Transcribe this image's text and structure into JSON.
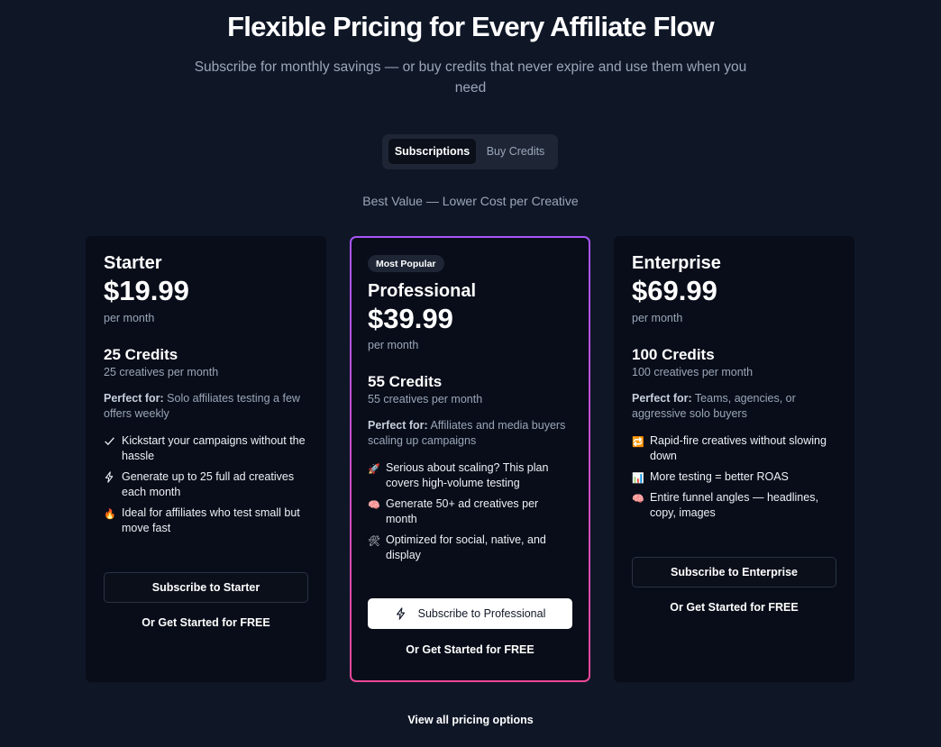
{
  "hero": {
    "title": "Flexible Pricing for Every Affiliate Flow",
    "subtitle": "Subscribe for monthly savings — or buy credits that never expire and use them when you need"
  },
  "toggle": {
    "active": "Subscriptions",
    "inactive": "Buy Credits"
  },
  "best_value": "Best Value — Lower Cost per Creative",
  "plans": [
    {
      "name": "Starter",
      "price": "$19.99",
      "period": "per month",
      "credits": "25 Credits",
      "credits_sub": "25 creatives per month",
      "perfect_label": "Perfect for:",
      "perfect_text": " Solo affiliates testing a few offers weekly",
      "features": [
        {
          "icon": "check-icon",
          "glyph": "✓",
          "text": "Kickstart your campaigns without the hassle"
        },
        {
          "icon": "lightning-icon",
          "glyph": "⚡",
          "text": "Generate up to 25 full ad creatives each month"
        },
        {
          "icon": "fire-icon",
          "glyph": "🔥",
          "text": "Ideal for affiliates who test small but move fast"
        }
      ],
      "button": "Subscribe to Starter",
      "free": "Or Get Started for FREE"
    },
    {
      "badge": "Most Popular",
      "name": "Professional",
      "price": "$39.99",
      "period": "per month",
      "credits": "55 Credits",
      "credits_sub": "55 creatives per month",
      "perfect_label": "Perfect for:",
      "perfect_text": " Affiliates and media buyers scaling up campaigns",
      "features": [
        {
          "icon": "rocket-icon",
          "glyph": "🚀",
          "text": "Serious about scaling? This plan covers high-volume testing"
        },
        {
          "icon": "brain-icon",
          "glyph": "🧠",
          "text": "Generate 50+ ad creatives per month"
        },
        {
          "icon": "tools-icon",
          "glyph": "🛠",
          "text": "Optimized for social, native, and display"
        }
      ],
      "button": "Subscribe to Professional",
      "free": "Or Get Started for FREE"
    },
    {
      "name": "Enterprise",
      "price": "$69.99",
      "period": "per month",
      "credits": "100 Credits",
      "credits_sub": "100 creatives per month",
      "perfect_label": "Perfect for:",
      "perfect_text": " Teams, agencies, or aggressive solo buyers",
      "features": [
        {
          "icon": "repeat-icon",
          "glyph": "🔁",
          "text": "Rapid-fire creatives without slowing down"
        },
        {
          "icon": "chart-icon",
          "glyph": "📊",
          "text": "More testing = better ROAS"
        },
        {
          "icon": "brain-icon",
          "glyph": "🧠",
          "text": "Entire funnel angles — headlines, copy, images"
        }
      ],
      "button": "Subscribe to Enterprise",
      "free": "Or Get Started for FREE"
    }
  ],
  "view_all": "View all pricing options",
  "colors": {
    "background": "#0f1727",
    "card": "#080d19",
    "accent_start": "#a855f7",
    "accent_end": "#ec4899"
  }
}
